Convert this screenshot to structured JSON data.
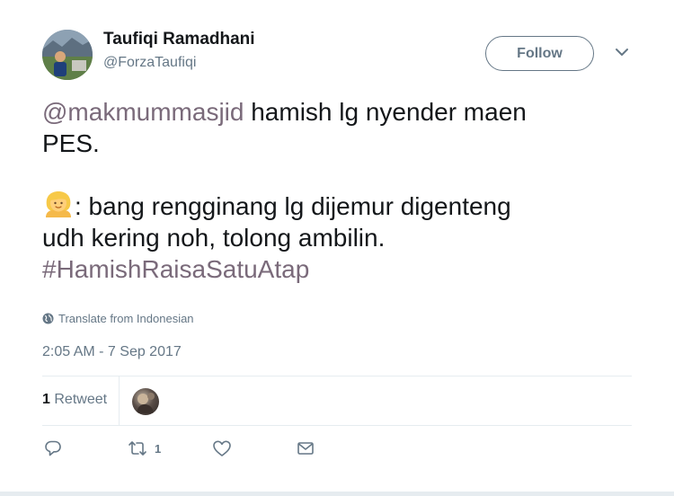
{
  "tweet": {
    "author": {
      "display_name": "Taufiqi Ramadhani",
      "handle": "@ForzaTaufiqi"
    },
    "follow_label": "Follow",
    "text": {
      "mention": "@makmummasjid",
      "line1_rest": " hamish lg nyender maen",
      "line2": "PES.",
      "line3_rest": ": bang rengginang lg dijemur digenteng",
      "line4": "udh kering noh, tolong ambilin.",
      "hashtag": "#HamishRaisaSatuAtap"
    },
    "emoji_icon": "person-blond-hair-emoji",
    "translate_label": "Translate from Indonesian",
    "timestamp": "2:05 AM - 7 Sep 2017",
    "retweets": {
      "count": "1",
      "label": "Retweet"
    },
    "actions": {
      "reply_icon": "reply-icon",
      "retweet_icon": "retweet-icon",
      "retweet_count": "1",
      "like_icon": "heart-icon",
      "dm_icon": "envelope-icon"
    },
    "colors": {
      "link": "#7a6a7a",
      "secondary_text": "#657786",
      "divider": "#e6ecf0"
    }
  }
}
